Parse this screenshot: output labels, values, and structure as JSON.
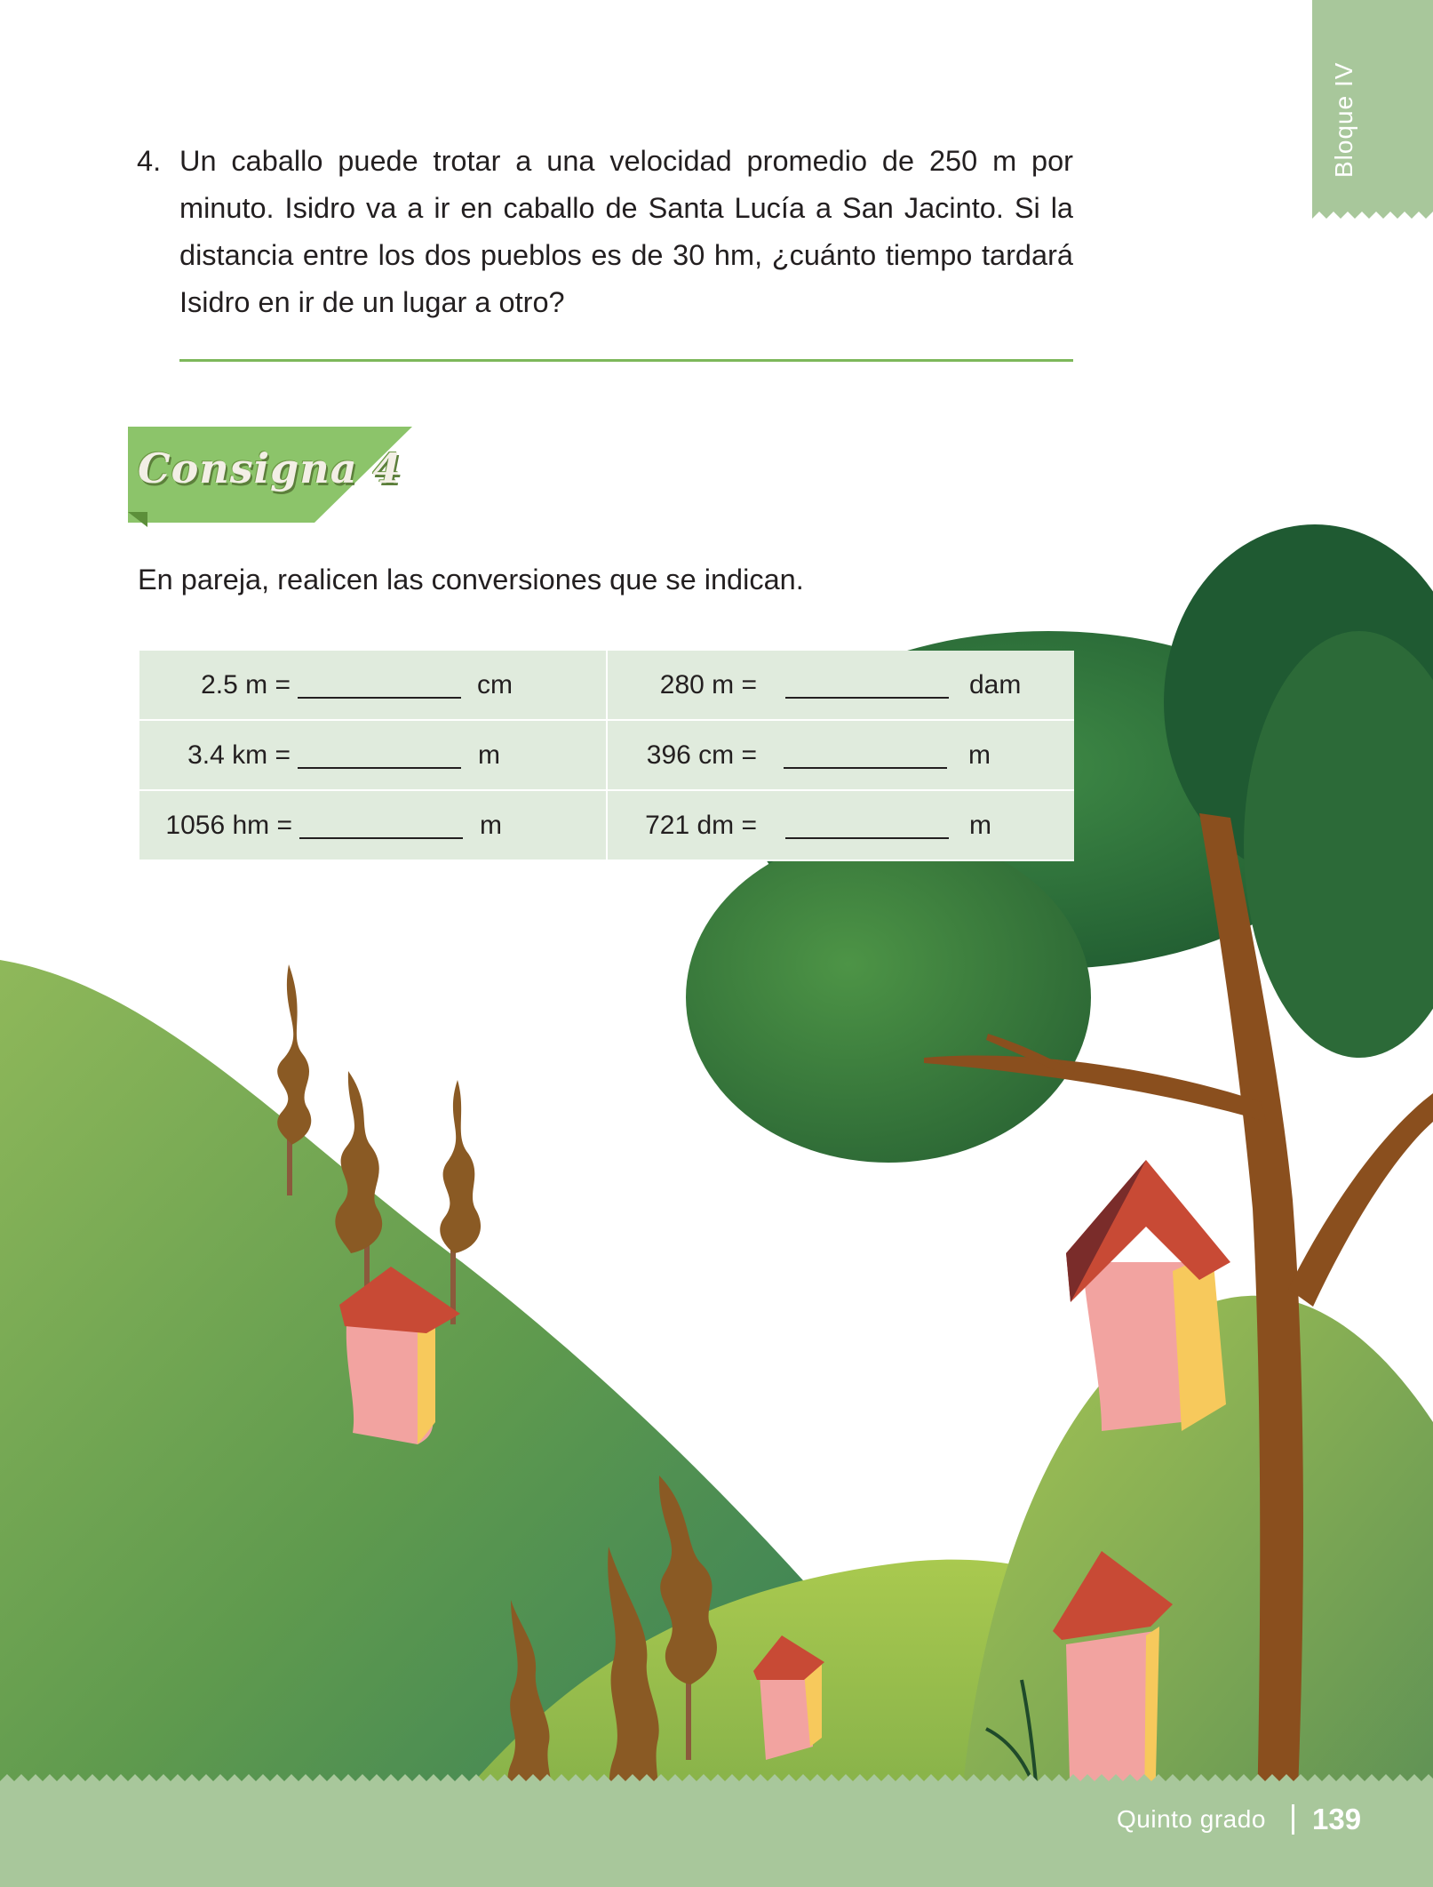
{
  "side_tab": {
    "label": "Bloque IV"
  },
  "problem": {
    "number": "4.",
    "text": "Un caballo puede trotar a una velocidad promedio de 250 m por minuto. Isidro va a ir en caballo de Santa Lucía a San Jacinto. Si la distancia entre los dos pueblos es de 30 hm, ¿cuánto tiempo tardará Isidro en ir de un lugar a otro?"
  },
  "consigna": {
    "title": "Consigna 4"
  },
  "instruction": "En pareja, realicen las conversiones que se indican.",
  "conversions": [
    {
      "lhs": "2.5 m =",
      "unit": "cm"
    },
    {
      "lhs": "280 m =",
      "unit": "dam"
    },
    {
      "lhs": "3.4 km =",
      "unit": "m"
    },
    {
      "lhs": "396 cm =",
      "unit": "m"
    },
    {
      "lhs": "1056 hm =",
      "unit": "m"
    },
    {
      "lhs": "721 dm =",
      "unit": "m"
    }
  ],
  "footer": {
    "grade": "Quinto grado",
    "page": "139"
  },
  "colors": {
    "tab_green": "#a8c79b",
    "consigna_green": "#8cc46a",
    "line_green": "#7db85a",
    "table_cell": "#e0ebdd"
  }
}
